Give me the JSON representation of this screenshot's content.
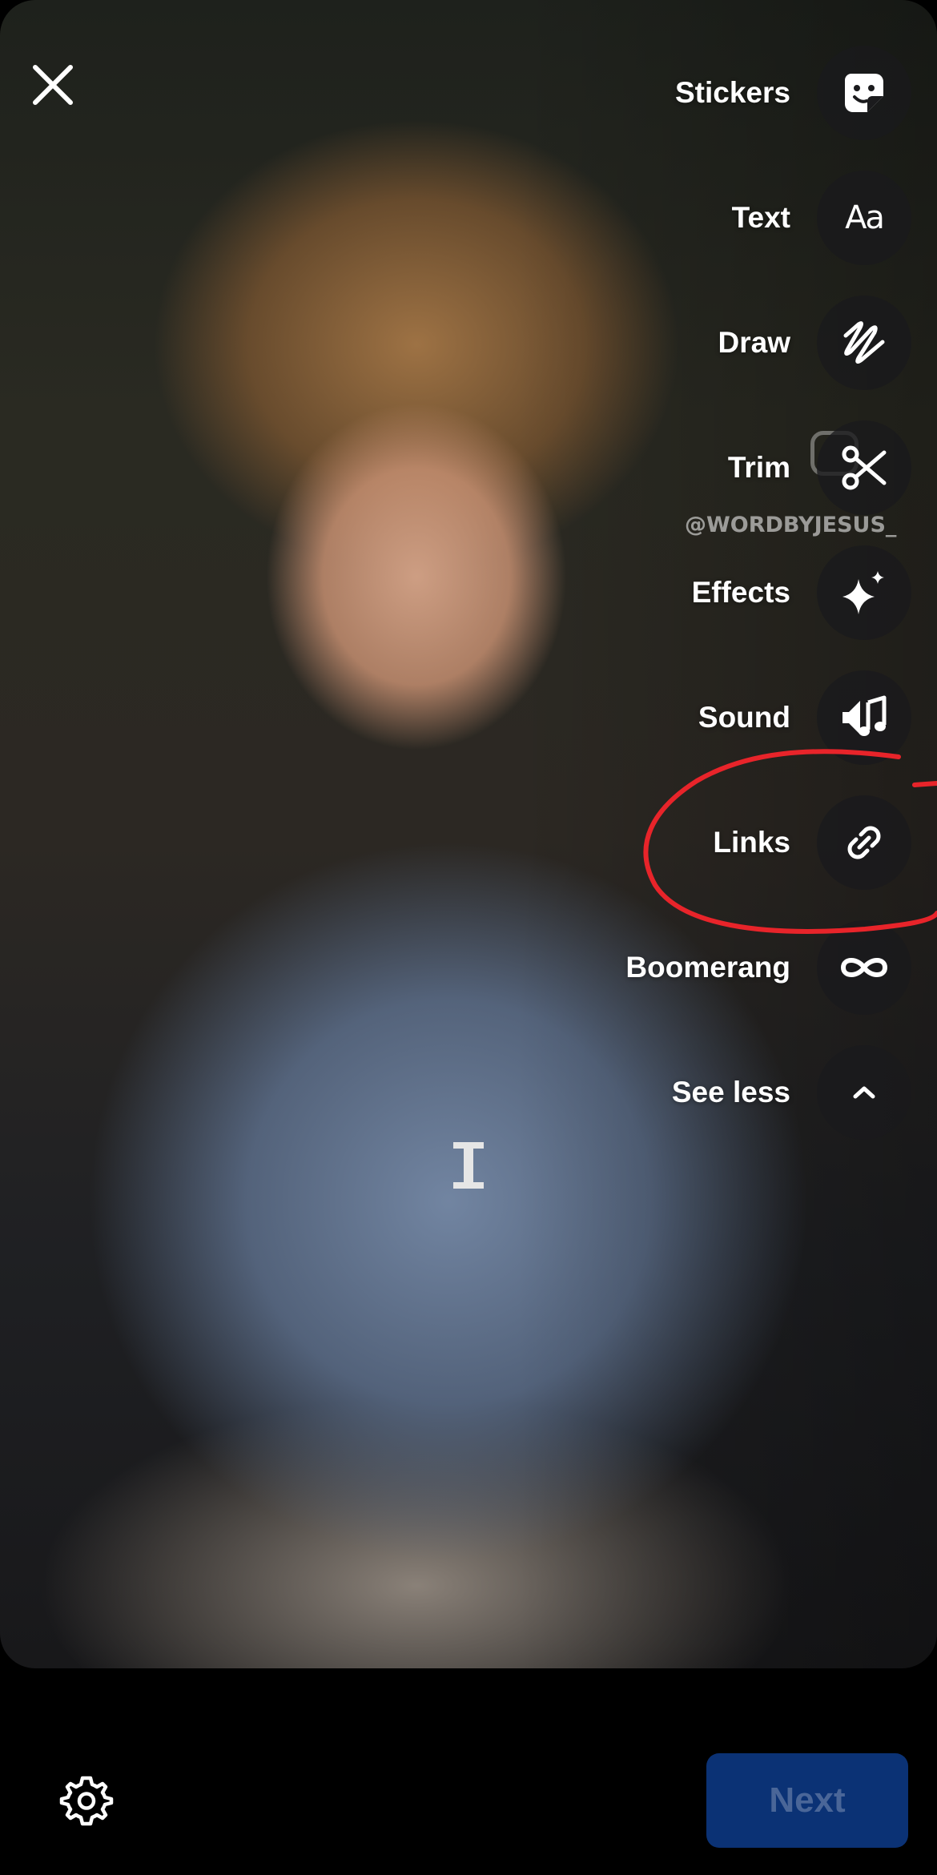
{
  "photo": {
    "watermark_text": "@WORDBYJESUS_"
  },
  "header": {
    "close_icon": "close-icon"
  },
  "tools": [
    {
      "label": "Stickers",
      "icon": "sticker-icon"
    },
    {
      "label": "Text",
      "icon": "text-aa-icon",
      "glyph": "Aa"
    },
    {
      "label": "Draw",
      "icon": "draw-squiggle-icon"
    },
    {
      "label": "Trim",
      "icon": "scissors-icon"
    },
    {
      "label": "Effects",
      "icon": "sparkles-icon"
    },
    {
      "label": "Sound",
      "icon": "sound-music-icon"
    },
    {
      "label": "Links",
      "icon": "link-icon"
    },
    {
      "label": "Boomerang",
      "icon": "infinity-icon"
    },
    {
      "label": "See less",
      "icon": "chevron-up-icon"
    }
  ],
  "annotation": {
    "color": "#e8242a",
    "target": "Links"
  },
  "footer": {
    "settings_icon": "gear-icon",
    "next_label": "Next",
    "next_color": "#0b3275",
    "next_text_color": "#4a6698"
  }
}
